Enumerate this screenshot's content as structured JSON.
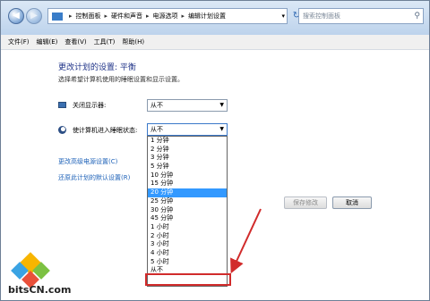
{
  "address": {
    "crumbs": [
      "控制面板",
      "硬件和声音",
      "电源选项",
      "编辑计划设置"
    ]
  },
  "search": {
    "placeholder": "搜索控制面板"
  },
  "menu": [
    "文件(F)",
    "编辑(E)",
    "查看(V)",
    "工具(T)",
    "帮助(H)"
  ],
  "page": {
    "title": "更改计划的设置: 平衡",
    "subtitle": "选择希望计算机使用的睡眠设置和显示设置。",
    "display_label": "关闭显示器:",
    "display_value": "从不",
    "sleep_label": "使计算机进入睡眠状态:",
    "sleep_value": "从不",
    "advanced_link": "更改高级电源设置(C)",
    "restore_link": "还原此计划的默认设置(R)",
    "save_button": "保存修改",
    "cancel_button": "取消"
  },
  "dropdown": {
    "options": [
      "1 分钟",
      "2 分钟",
      "3 分钟",
      "5 分钟",
      "10 分钟",
      "15 分钟",
      "20 分钟",
      "25 分钟",
      "30 分钟",
      "45 分钟",
      "1 小时",
      "2 小时",
      "3 小时",
      "4 小时",
      "5 小时",
      "从不"
    ],
    "selected_index": 6
  },
  "watermark": {
    "text": "bitsCN.com"
  },
  "colors": {
    "highlight": "#3399ff",
    "annotation": "#d12b2b",
    "title": "#1e3287",
    "link": "#1e62b8"
  }
}
